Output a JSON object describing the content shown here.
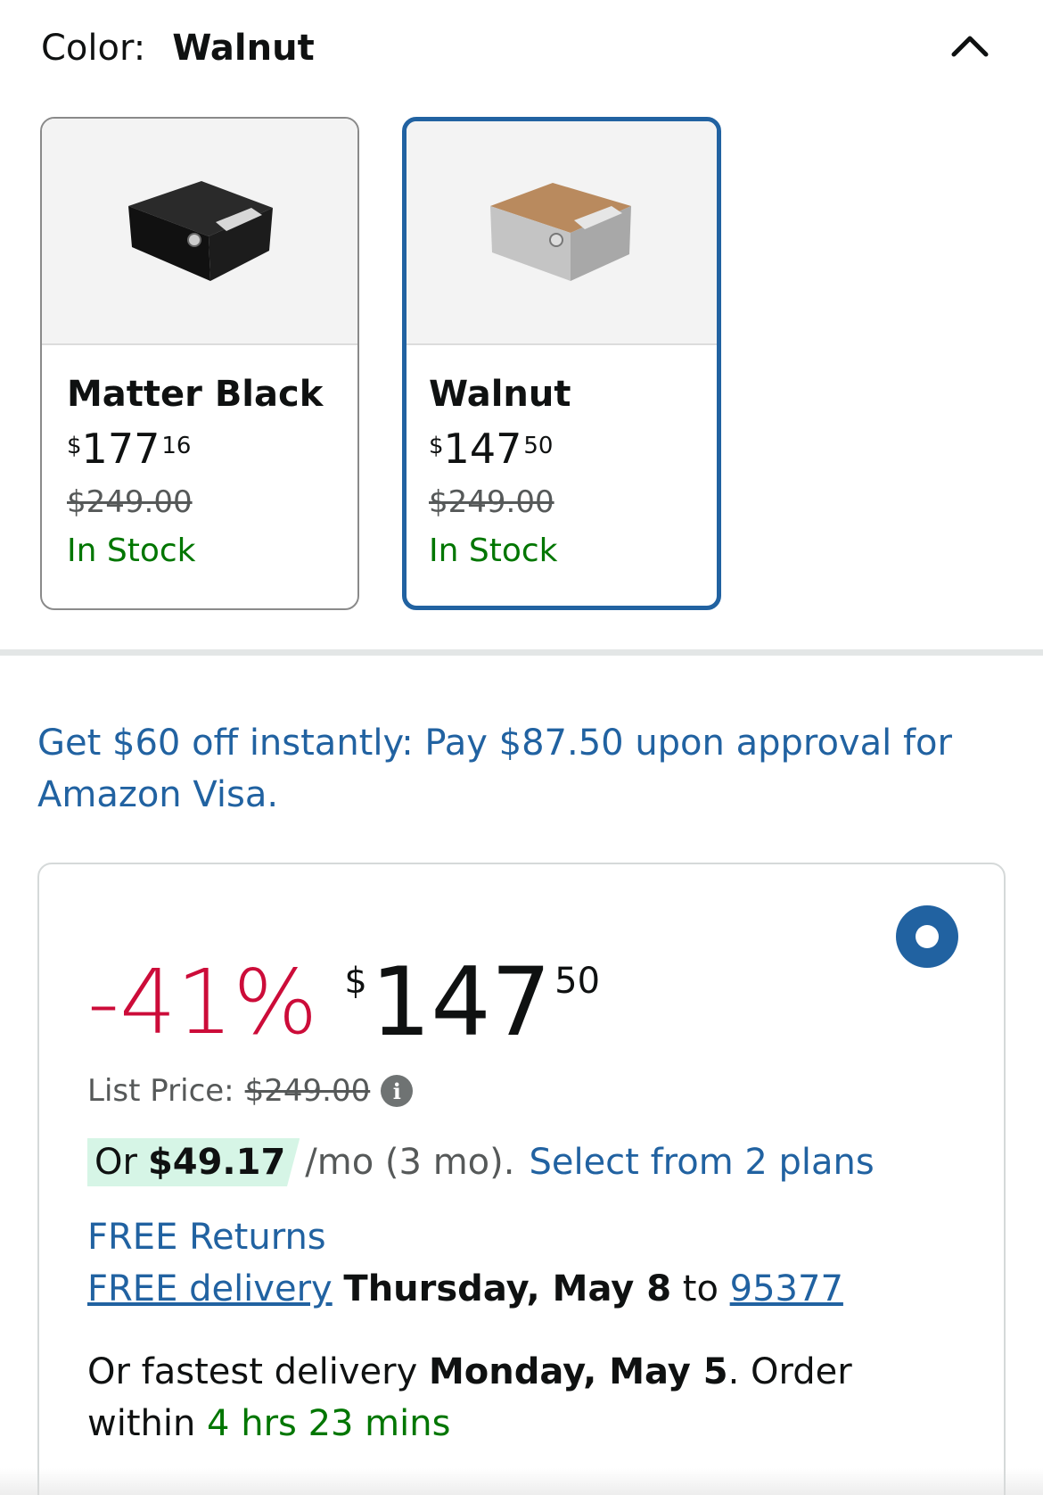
{
  "color_selector": {
    "label": "Color:",
    "selected": "Walnut",
    "swatches": [
      {
        "name": "Matter Black",
        "price_currency": "$",
        "price_whole": "177",
        "price_fraction": "16",
        "list_price": "$249.00",
        "stock": "In Stock",
        "selected": false
      },
      {
        "name": "Walnut",
        "price_currency": "$",
        "price_whole": "147",
        "price_fraction": "50",
        "list_price": "$249.00",
        "stock": "In Stock",
        "selected": true
      }
    ]
  },
  "promo": {
    "text": "Get $60 off instantly: Pay $87.50 upon approval for Amazon Visa."
  },
  "buybox": {
    "discount": "-41%",
    "price_currency": "$",
    "price_whole": "147",
    "price_fraction": "50",
    "list_price_label": "List Price:",
    "list_price": "$249.00",
    "info_glyph": "i",
    "monthly_prefix": "Or",
    "monthly_amount": "$49.17",
    "monthly_suffix": "/mo (3 mo).",
    "plans_link": "Select from 2 plans",
    "returns": "FREE Returns",
    "delivery_link": "FREE delivery",
    "delivery_date": "Thursday, May 8",
    "delivery_to": "to",
    "zip": "95377",
    "fastest_prefix": "Or fastest delivery",
    "fastest_date": "Monday, May 5",
    "fastest_mid": ". Order within",
    "countdown": "4 hrs 23 mins"
  },
  "colors": {
    "link": "#2162a1",
    "deal_red": "#cc0c39",
    "stock_green": "#007600",
    "selected_border": "#2162a1",
    "pill_green": "#d6f5e6"
  },
  "icons": {
    "collapse": "chevron-up-icon",
    "info": "info-icon",
    "radio": "radio-selected-icon"
  }
}
